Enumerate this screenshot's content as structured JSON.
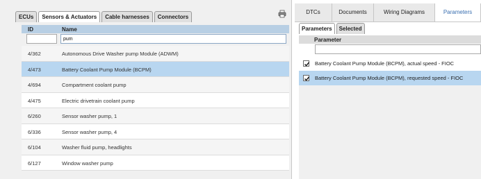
{
  "left_panel": {
    "tabs": [
      {
        "label": "ECUs"
      },
      {
        "label": "Sensors & Actuators"
      },
      {
        "label": "Cable harnesses"
      },
      {
        "label": "Connectors"
      }
    ],
    "columns": {
      "id": "ID",
      "name": "Name"
    },
    "filter": {
      "id_value": "",
      "name_value": "pum"
    },
    "rows": [
      {
        "id": "4/362",
        "name": "Autonomous Drive Washer pump Module (ADWM)"
      },
      {
        "id": "4/473",
        "name": "Battery Coolant Pump Module (BCPM)",
        "selected": true
      },
      {
        "id": "4/694",
        "name": "Compartment coolant pump"
      },
      {
        "id": "4/475",
        "name": "Electric drivetrain coolant pump"
      },
      {
        "id": "6/260",
        "name": "Sensor washer pump, 1"
      },
      {
        "id": "6/336",
        "name": "Sensor washer pump, 4"
      },
      {
        "id": "6/104",
        "name": "Washer fluid pump, headlights"
      },
      {
        "id": "6/127",
        "name": "Window washer pump"
      }
    ]
  },
  "right_panel": {
    "tabs": [
      {
        "label": "DTCs"
      },
      {
        "label": "Documents"
      },
      {
        "label": "Wiring Diagrams"
      },
      {
        "label": "Parameters",
        "active": true
      }
    ],
    "sub_tabs": [
      {
        "label": "Parameters"
      },
      {
        "label": "Selected"
      }
    ],
    "column": "Parameter",
    "filter_value": "",
    "rows": [
      {
        "label": "Battery Coolant Pump Module (BCPM), actual speed - FIOC",
        "checked": true
      },
      {
        "label": "Battery Coolant Pump Module (BCPM), requested speed - FIOC",
        "checked": true,
        "selected": true
      }
    ]
  },
  "icons": {
    "print": "printer-icon",
    "check": "checkmark-icon"
  }
}
